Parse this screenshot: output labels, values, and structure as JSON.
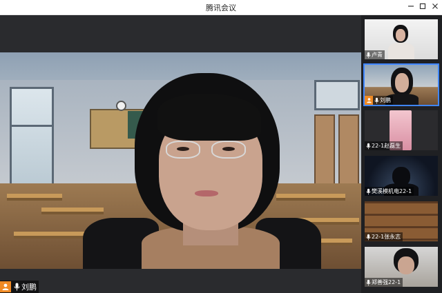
{
  "window": {
    "title": "腾讯会议"
  },
  "main_video": {
    "participant_name": "刘鹏",
    "is_host": true
  },
  "participants": [
    {
      "name": "卢青",
      "is_host": false,
      "active": false
    },
    {
      "name": "刘鹏",
      "is_host": true,
      "active": true
    },
    {
      "name": "22-1赵磊生",
      "is_host": false,
      "active": false
    },
    {
      "name": "樊溪模机电22-1",
      "is_host": false,
      "active": false
    },
    {
      "name": "22-1张永志",
      "is_host": false,
      "active": false
    },
    {
      "name": "郑善强22-1",
      "is_host": false,
      "active": false
    }
  ],
  "colors": {
    "host_badge": "#f08a24",
    "active_outline": "#3f86ff"
  },
  "icons": {
    "host": "person-icon",
    "mic": "microphone-icon",
    "minimize": "minimize-icon",
    "maximize": "maximize-icon",
    "close": "close-icon"
  }
}
